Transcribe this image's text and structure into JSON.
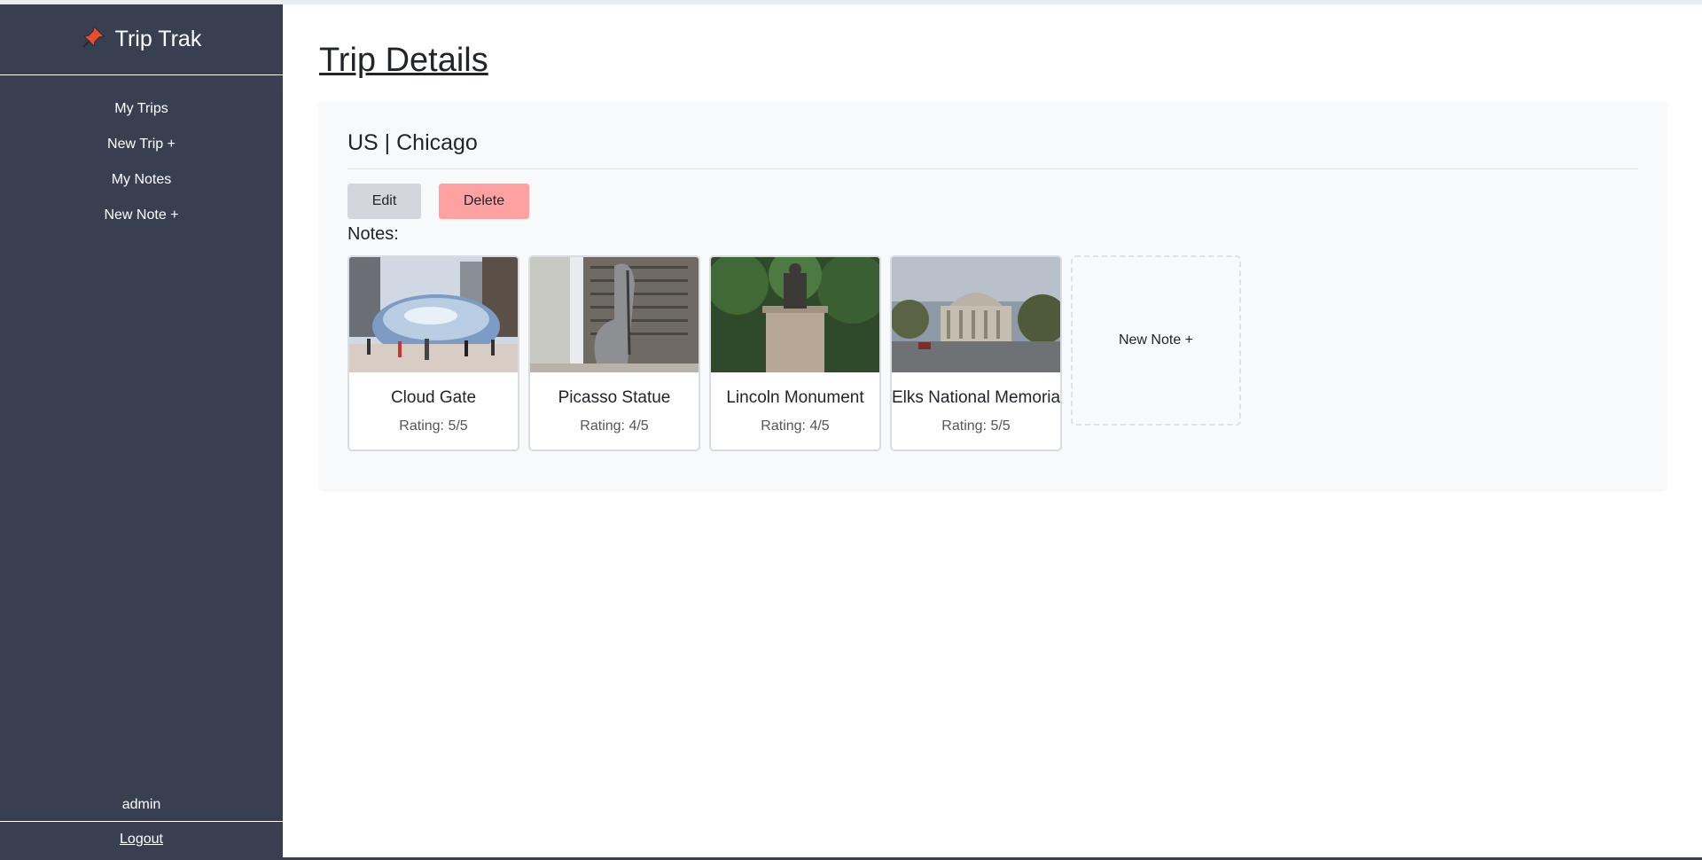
{
  "app": {
    "brand": "Trip Trak",
    "brand_icon": "pushpin-icon"
  },
  "sidebar": {
    "items": [
      {
        "label": "My Trips"
      },
      {
        "label": "New Trip +"
      },
      {
        "label": "My Notes"
      },
      {
        "label": "New Note +"
      }
    ],
    "user": "admin",
    "logout": "Logout"
  },
  "main": {
    "title": "Trip Details",
    "trip": {
      "title": "US | Chicago",
      "edit_label": "Edit",
      "delete_label": "Delete",
      "notes_label": "Notes:",
      "notes": [
        {
          "title": "Cloud Gate",
          "rating": "Rating: 5/5"
        },
        {
          "title": "Picasso Statue",
          "rating": "Rating: 4/5"
        },
        {
          "title": "Lincoln Monument",
          "rating": "Rating: 4/5"
        },
        {
          "title": "Elks National Memorial",
          "rating": "Rating: 5/5"
        }
      ],
      "new_note_label": "New Note +"
    }
  },
  "colors": {
    "sidebar_bg": "#373f51",
    "delete_bg": "#ffa1a1",
    "edit_bg": "#d3d6db",
    "card_bg": "#f8f9fa"
  }
}
